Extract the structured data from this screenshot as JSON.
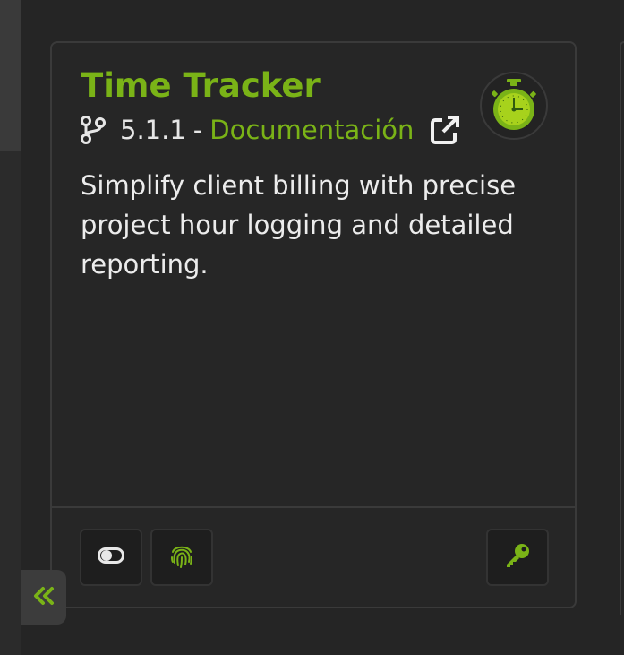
{
  "card": {
    "title": "Time Tracker",
    "version": "5.1.1",
    "separator": "-",
    "doc_link_label": "Documentación",
    "description": "Simplify client billing with precise project hour logging and detailed reporting."
  },
  "icons": {
    "branch": "code-branch-icon",
    "external_link": "external-link-icon",
    "app_logo": "stopwatch-icon",
    "toggle": "toggle-icon",
    "fingerprint": "fingerprint-icon",
    "key": "key-icon",
    "collapse": "double-chevron-left-icon"
  },
  "colors": {
    "accent": "#7ab317",
    "background": "#252525",
    "card": "#262626",
    "button": "#1e1e1e",
    "text": "#ececec"
  }
}
